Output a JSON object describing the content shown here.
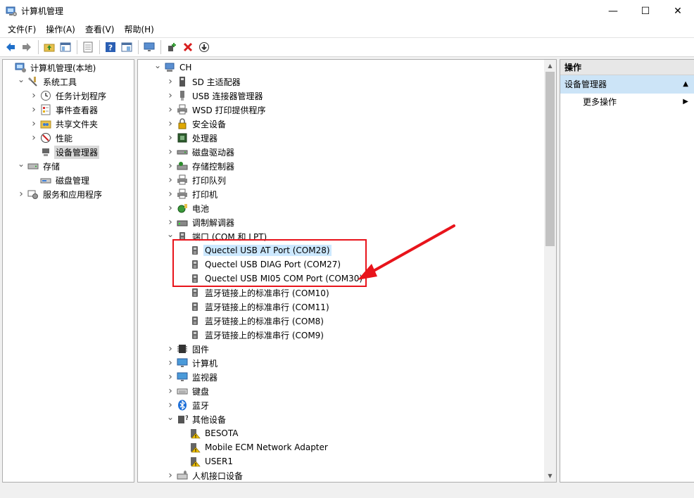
{
  "window": {
    "title": "计算机管理",
    "minimize": "—",
    "maximize": "☐",
    "close": "✕"
  },
  "menu": [
    "文件(F)",
    "操作(A)",
    "查看(V)",
    "帮助(H)"
  ],
  "toolbar": [
    "back-icon",
    "forward-icon",
    "up-folder-icon",
    "show-tree-icon",
    "export-icon",
    "help-icon",
    "properties-icon",
    "monitor-icon",
    "add-driver-icon",
    "uninstall-icon",
    "download-icon"
  ],
  "left_tree": [
    {
      "label": "计算机管理(本地)",
      "level": 0,
      "expanded": "none",
      "icon": "computer-management-icon"
    },
    {
      "label": "系统工具",
      "level": 1,
      "expanded": "open",
      "icon": "tools-icon"
    },
    {
      "label": "任务计划程序",
      "level": 2,
      "expanded": "closed",
      "icon": "clock-icon"
    },
    {
      "label": "事件查看器",
      "level": 2,
      "expanded": "closed",
      "icon": "event-viewer-icon"
    },
    {
      "label": "共享文件夹",
      "level": 2,
      "expanded": "closed",
      "icon": "shared-folder-icon"
    },
    {
      "label": "性能",
      "level": 2,
      "expanded": "closed",
      "icon": "performance-icon"
    },
    {
      "label": "设备管理器",
      "level": 2,
      "expanded": "none",
      "icon": "device-manager-icon",
      "selected": "true"
    },
    {
      "label": "存储",
      "level": 1,
      "expanded": "open",
      "icon": "storage-icon"
    },
    {
      "label": "磁盘管理",
      "level": 2,
      "expanded": "none",
      "icon": "disk-management-icon"
    },
    {
      "label": "服务和应用程序",
      "level": 1,
      "expanded": "closed",
      "icon": "services-icon"
    }
  ],
  "device_tree": [
    {
      "label": "CH",
      "level": 0,
      "expanded": "open",
      "icon": "computer-icon"
    },
    {
      "label": "SD 主适配器",
      "level": 1,
      "expanded": "closed",
      "icon": "sd-adapter-icon"
    },
    {
      "label": "USB 连接器管理器",
      "level": 1,
      "expanded": "closed",
      "icon": "usb-icon"
    },
    {
      "label": "WSD 打印提供程序",
      "level": 1,
      "expanded": "closed",
      "icon": "printer-icon"
    },
    {
      "label": "安全设备",
      "level": 1,
      "expanded": "closed",
      "icon": "security-device-icon"
    },
    {
      "label": "处理器",
      "level": 1,
      "expanded": "closed",
      "icon": "processor-icon"
    },
    {
      "label": "磁盘驱动器",
      "level": 1,
      "expanded": "closed",
      "icon": "disk-drive-icon"
    },
    {
      "label": "存储控制器",
      "level": 1,
      "expanded": "closed",
      "icon": "storage-controller-icon"
    },
    {
      "label": "打印队列",
      "level": 1,
      "expanded": "closed",
      "icon": "printer-icon"
    },
    {
      "label": "打印机",
      "level": 1,
      "expanded": "closed",
      "icon": "printer-icon"
    },
    {
      "label": "电池",
      "level": 1,
      "expanded": "closed",
      "icon": "battery-icon"
    },
    {
      "label": "调制解调器",
      "level": 1,
      "expanded": "closed",
      "icon": "modem-icon"
    },
    {
      "label": "端口 (COM 和 LPT)",
      "level": 1,
      "expanded": "open",
      "icon": "port-icon"
    },
    {
      "label": "Quectel USB AT Port (COM28)",
      "level": 2,
      "expanded": "none",
      "icon": "port-icon",
      "selected": "true"
    },
    {
      "label": "Quectel USB DIAG Port (COM27)",
      "level": 2,
      "expanded": "none",
      "icon": "port-icon"
    },
    {
      "label": "Quectel USB MI05 COM Port (COM30)",
      "level": 2,
      "expanded": "none",
      "icon": "port-icon"
    },
    {
      "label": "蓝牙链接上的标准串行 (COM10)",
      "level": 2,
      "expanded": "none",
      "icon": "port-icon"
    },
    {
      "label": "蓝牙链接上的标准串行 (COM11)",
      "level": 2,
      "expanded": "none",
      "icon": "port-icon"
    },
    {
      "label": "蓝牙链接上的标准串行 (COM8)",
      "level": 2,
      "expanded": "none",
      "icon": "port-icon"
    },
    {
      "label": "蓝牙链接上的标准串行 (COM9)",
      "level": 2,
      "expanded": "none",
      "icon": "port-icon"
    },
    {
      "label": "固件",
      "level": 1,
      "expanded": "closed",
      "icon": "firmware-icon"
    },
    {
      "label": "计算机",
      "level": 1,
      "expanded": "closed",
      "icon": "monitor-icon"
    },
    {
      "label": "监视器",
      "level": 1,
      "expanded": "closed",
      "icon": "monitor-icon"
    },
    {
      "label": "键盘",
      "level": 1,
      "expanded": "closed",
      "icon": "keyboard-icon"
    },
    {
      "label": "蓝牙",
      "level": 1,
      "expanded": "closed",
      "icon": "bluetooth-icon"
    },
    {
      "label": "其他设备",
      "level": 1,
      "expanded": "open",
      "icon": "other-devices-icon"
    },
    {
      "label": "BESOTA",
      "level": 2,
      "expanded": "none",
      "icon": "unknown-device-icon"
    },
    {
      "label": "Mobile ECM Network Adapter",
      "level": 2,
      "expanded": "none",
      "icon": "unknown-device-icon"
    },
    {
      "label": "USER1",
      "level": 2,
      "expanded": "none",
      "icon": "unknown-device-icon"
    },
    {
      "label": "人机接口设备",
      "level": 1,
      "expanded": "closed",
      "icon": "hid-icon"
    }
  ],
  "actions": {
    "header": "操作",
    "group": "设备管理器",
    "more": "更多操作"
  },
  "colors": {
    "selection": "#cce8ff",
    "annotation_red": "#e8141b"
  }
}
